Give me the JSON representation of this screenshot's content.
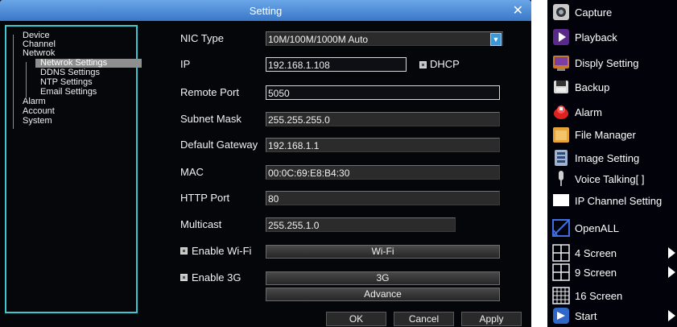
{
  "dialog": {
    "title": "Setting"
  },
  "tree": {
    "items": [
      "Device",
      "Channel",
      "Netwrok",
      "Netwrok Settings",
      "DDNS Settings",
      "NTP Settings",
      "Email Settings",
      "Alarm",
      "Account",
      "System"
    ],
    "selected": "Netwrok Settings"
  },
  "form": {
    "nic_type": {
      "label": "NIC Type",
      "value": "10M/100M/1000M Auto"
    },
    "ip": {
      "label": "IP",
      "value": "192.168.1.108"
    },
    "dhcp": {
      "label": "DHCP"
    },
    "remote_port": {
      "label": "Remote Port",
      "value": "5050"
    },
    "subnet_mask": {
      "label": "Subnet Mask",
      "value": "255.255.255.0"
    },
    "default_gateway": {
      "label": "Default Gateway",
      "value": "192.168.1.1"
    },
    "mac": {
      "label": "MAC",
      "value": "00:0C:69:E8:B4:30"
    },
    "http_port": {
      "label": "HTTP Port",
      "value": "80"
    },
    "multicast": {
      "label": "Multicast",
      "value": "255.255.1.0"
    },
    "wifi": {
      "label": "Enable Wi-Fi",
      "button": "Wi-Fi"
    },
    "g3": {
      "label": "Enable 3G",
      "button": "3G"
    },
    "advance": "Advance"
  },
  "buttons": {
    "ok": "OK",
    "cancel": "Cancel",
    "apply": "Apply"
  },
  "menu": {
    "items": [
      {
        "label": "Capture",
        "icon": "camera-icon"
      },
      {
        "label": "Playback",
        "icon": "play-icon"
      },
      {
        "label": "Disply Setting",
        "icon": "display-icon"
      },
      {
        "label": "Backup",
        "icon": "backup-icon"
      },
      {
        "label": "Alarm",
        "icon": "alarm-icon"
      },
      {
        "label": "File Manager",
        "icon": "folder-icon"
      },
      {
        "label": "Image Setting",
        "icon": "image-setting-icon"
      },
      {
        "label": "Voice Talking[ ]",
        "icon": "microphone-icon"
      },
      {
        "label": "IP Channel Setting",
        "icon": "ip-channel-icon"
      },
      {
        "label": "OpenALL",
        "icon": "checkbox-icon"
      },
      {
        "label": "4 Screen",
        "icon": "grid-4-icon"
      },
      {
        "label": "9 Screen",
        "icon": "grid-9-icon"
      },
      {
        "label": "16 Screen",
        "icon": "grid-16-icon"
      },
      {
        "label": "Start",
        "icon": "start-icon"
      }
    ]
  },
  "colors": {
    "title_bar": "#3a77c7",
    "tree_border": "#3fc7d0",
    "select_arrow": "#3e97d6"
  }
}
